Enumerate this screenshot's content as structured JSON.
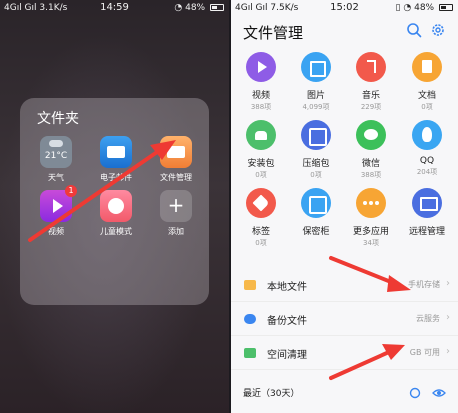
{
  "left": {
    "status": {
      "signal": "4Gıl Gıl",
      "speed": "3.1K/s",
      "time": "14:59",
      "battery": "48%"
    },
    "folder_title": "文件夹",
    "apps": [
      {
        "label": "天气",
        "icon": "weather-icon",
        "icon_text": "21°C"
      },
      {
        "label": "电子邮件",
        "icon": "mail-icon"
      },
      {
        "label": "文件管理",
        "icon": "folder-icon"
      },
      {
        "label": "视频",
        "icon": "video-icon",
        "badge": "1"
      },
      {
        "label": "儿童模式",
        "icon": "kids-mode-icon"
      },
      {
        "label": "添加",
        "icon": "add-icon",
        "icon_text": "+"
      }
    ]
  },
  "right": {
    "status": {
      "signal": "4Gıl Gıl",
      "speed": "7.5K/s",
      "time": "15:02",
      "battery": "48%"
    },
    "title": "文件管理",
    "categories": [
      {
        "name": "视频",
        "count": "388项",
        "color": "#8e5ce6",
        "icon": "video-icon"
      },
      {
        "name": "图片",
        "count": "4,099项",
        "color": "#3aa3f2",
        "icon": "image-icon"
      },
      {
        "name": "音乐",
        "count": "229项",
        "color": "#f2594b",
        "icon": "music-icon"
      },
      {
        "name": "文档",
        "count": "0项",
        "color": "#f7a534",
        "icon": "document-icon"
      },
      {
        "name": "安装包",
        "count": "0项",
        "color": "#4cbf6b",
        "icon": "android-icon"
      },
      {
        "name": "压缩包",
        "count": "0项",
        "color": "#4a6ee0",
        "icon": "archive-icon"
      },
      {
        "name": "微信",
        "count": "388项",
        "color": "#3cc05a",
        "icon": "wechat-icon"
      },
      {
        "name": "QQ",
        "count": "204项",
        "color": "#3aa6f2",
        "icon": "qq-icon"
      },
      {
        "name": "标签",
        "count": "0项",
        "color": "#f2594b",
        "icon": "tag-icon"
      },
      {
        "name": "保密柜",
        "count": "",
        "color": "#3aa3f2",
        "icon": "safe-icon"
      },
      {
        "name": "更多应用",
        "count": "34项",
        "color": "#f7a534",
        "icon": "more-apps-icon"
      },
      {
        "name": "远程管理",
        "count": "",
        "color": "#4a6ee0",
        "icon": "remote-manage-icon"
      }
    ],
    "rows": [
      {
        "label": "本地文件",
        "value": "手机存储",
        "icon_color": "#f7b84a"
      },
      {
        "label": "备份文件",
        "value": "云服务",
        "icon_color": "#3a86f0"
      },
      {
        "label": "空间清理",
        "value": "GB 可用",
        "icon_color": "#4cbf6b"
      }
    ],
    "recent_label": "最近（30天）"
  },
  "arrow_color": "#ee3a33"
}
